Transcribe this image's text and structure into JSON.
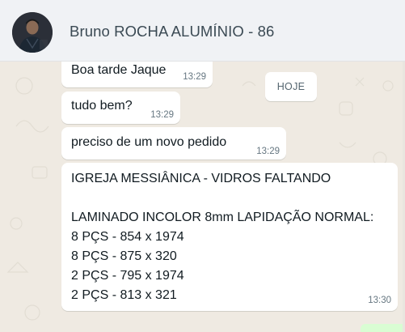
{
  "header": {
    "contact_name": "Bruno ROCHA ALUMÍNIO - 86"
  },
  "date_pill": "HOJE",
  "messages": [
    {
      "text": "Boa tarde Jaque",
      "time": "13:29"
    },
    {
      "text": "tudo bem?",
      "time": "13:29"
    },
    {
      "text": "preciso de um novo pedido",
      "time": "13:29"
    },
    {
      "lines": [
        "IGREJA MESSIÂNICA - VIDROS FALTANDO",
        "",
        "LAMINADO INCOLOR 8mm LAPIDAÇÃO NORMAL:",
        "8 PÇS - 854 x 1974",
        "8 PÇS - 875 x 320",
        "2 PÇS - 795 x 1974",
        "2 PÇS - 813 x 321"
      ],
      "time": "13:30"
    }
  ],
  "colors": {
    "chat_background": "#efeae2",
    "header_background": "#f0f2f5",
    "bubble_background": "#ffffff",
    "outgoing_accent": "#d9fdd3"
  }
}
